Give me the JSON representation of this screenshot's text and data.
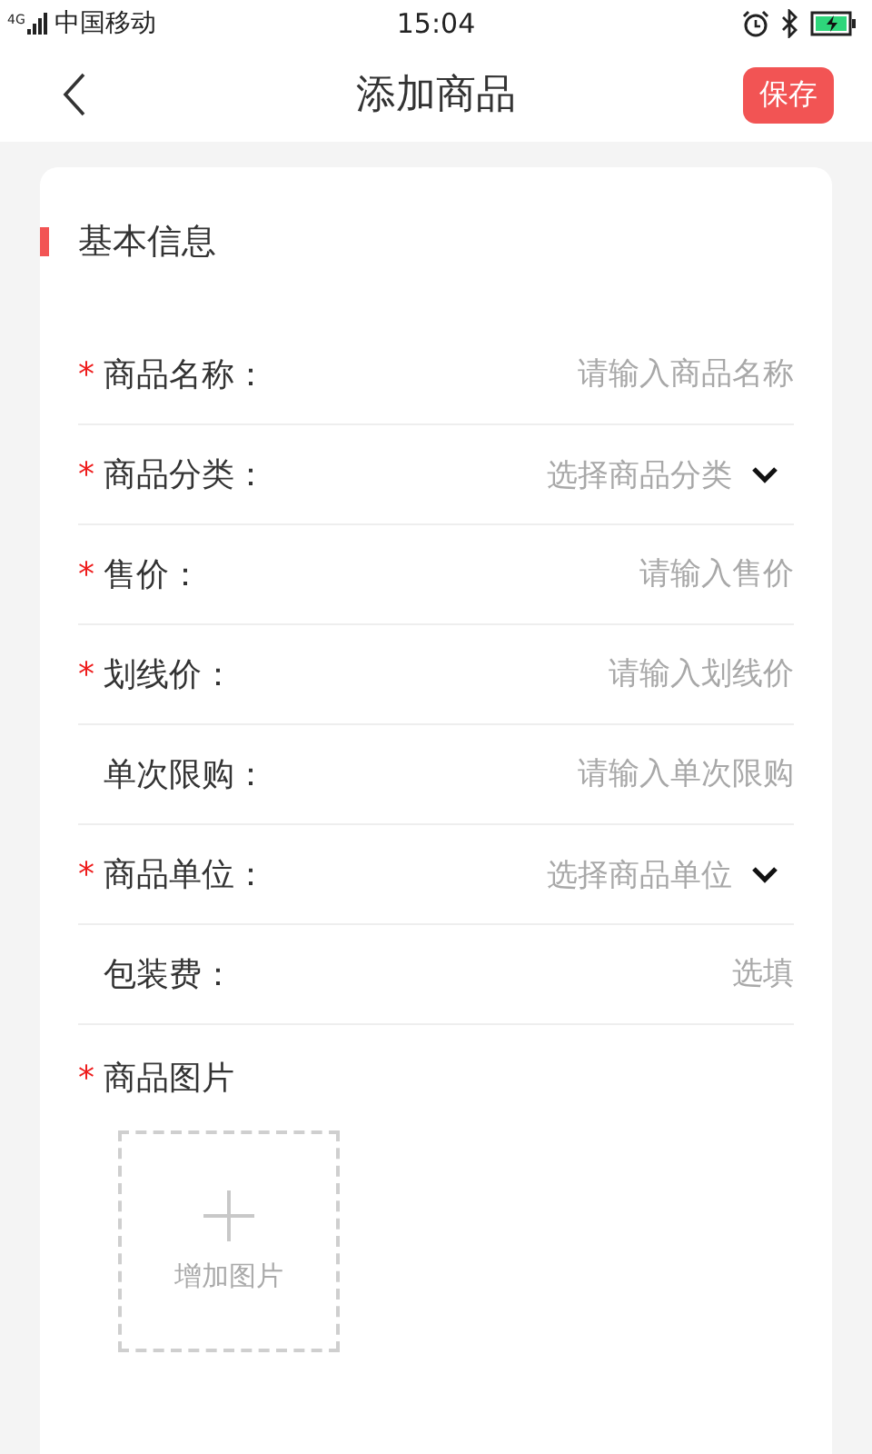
{
  "status_bar": {
    "network": "4G",
    "carrier": "中国移动",
    "time": "15:04"
  },
  "header": {
    "title": "添加商品",
    "save_button": "保存"
  },
  "section": {
    "title": "基本信息"
  },
  "fields": [
    {
      "kind": "input",
      "required": true,
      "label": "商品名称：",
      "placeholder": "请输入商品名称"
    },
    {
      "kind": "select",
      "required": true,
      "label": "商品分类：",
      "placeholder": "选择商品分类"
    },
    {
      "kind": "input",
      "required": true,
      "label": "售价：",
      "placeholder": "请输入售价"
    },
    {
      "kind": "input",
      "required": true,
      "label": "划线价：",
      "placeholder": "请输入划线价"
    },
    {
      "kind": "input",
      "required": false,
      "label": "单次限购：",
      "placeholder": "请输入单次限购"
    },
    {
      "kind": "select",
      "required": true,
      "label": "商品单位：",
      "placeholder": "选择商品单位"
    },
    {
      "kind": "input",
      "required": false,
      "label": "包装费：",
      "placeholder": "选填"
    }
  ],
  "images": {
    "required": true,
    "label": "商品图片",
    "upload_label": "增加图片"
  },
  "required_mark": "*"
}
